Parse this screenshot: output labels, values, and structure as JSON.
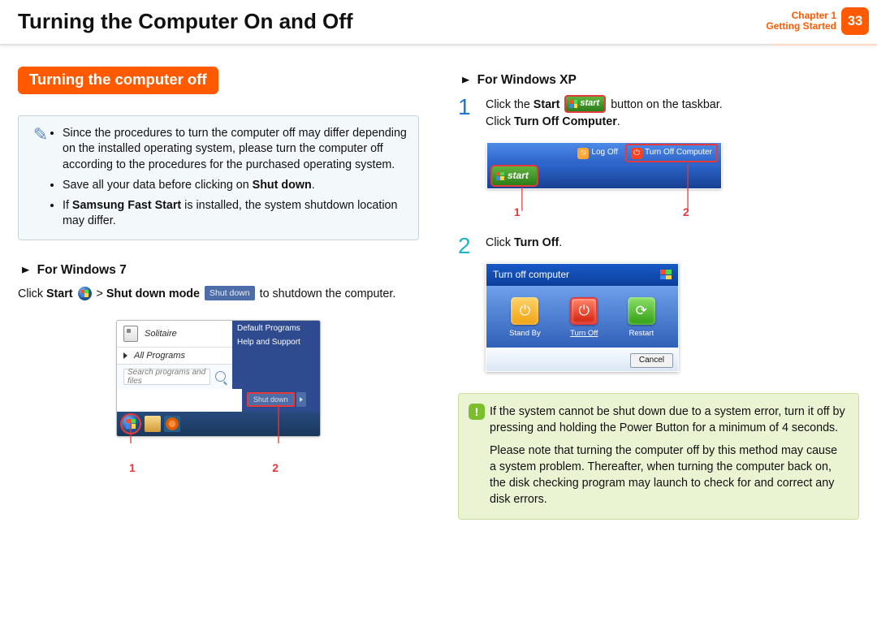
{
  "header": {
    "title": "Turning the Computer On and Off",
    "chapter_label": "Chapter 1",
    "chapter_name": "Getting Started",
    "page_number": "33"
  },
  "section_bar": "Turning the computer off",
  "info_box": {
    "items": [
      "Since the procedures to turn the computer off may differ depending on the installed operating system, please turn the computer off according to the procedures for the purchased operating system.",
      "Save all your data before clicking on <b>Shut down</b>.",
      "If <b>Samsung Fast Start</b> is installed, the system shutdown location may differ."
    ]
  },
  "win7": {
    "heading": "For Windows 7",
    "triangle": "►",
    "line_pre": "Click ",
    "line_start": "Start",
    "line_gt": " > ",
    "line_mode": "Shut down mode",
    "shutdown_btn_text": "Shut down",
    "line_post": " to shutdown the computer.",
    "menu": {
      "solitaire": "Solitaire",
      "all_programs": "All Programs",
      "search_placeholder": "Search programs and files",
      "right_items": [
        "Default Programs",
        "Help and Support"
      ],
      "shutdown": "Shut down"
    },
    "callouts": [
      "1",
      "2"
    ]
  },
  "winxp": {
    "heading": "For Windows XP",
    "triangle": "►",
    "step1_a": "Click the ",
    "step1_b": "Start",
    "start_label": "start",
    "step1_c": " button on the taskbar.",
    "step1_d": "Click ",
    "step1_e": "Turn Off Computer",
    "step1_f": ".",
    "taskbar": {
      "logoff": "Log Off",
      "turnoff": "Turn Off Computer",
      "start": "start"
    },
    "callouts": [
      "1",
      "2"
    ],
    "step2_a": "Click ",
    "step2_b": "Turn Off",
    "step2_c": ".",
    "dialog": {
      "title": "Turn off computer",
      "standby": "Stand By",
      "turnoff": "Turn Off",
      "restart": "Restart",
      "cancel": "Cancel"
    }
  },
  "warning": {
    "p1": "If the system cannot be shut down due to a system error, turn it off by pressing and holding the Power Button for a minimum of 4 seconds.",
    "p2": "Please note that turning the computer off by this method may cause a system problem. Thereafter, when turning the computer back on, the disk checking program may launch to check for and correct any disk errors."
  }
}
